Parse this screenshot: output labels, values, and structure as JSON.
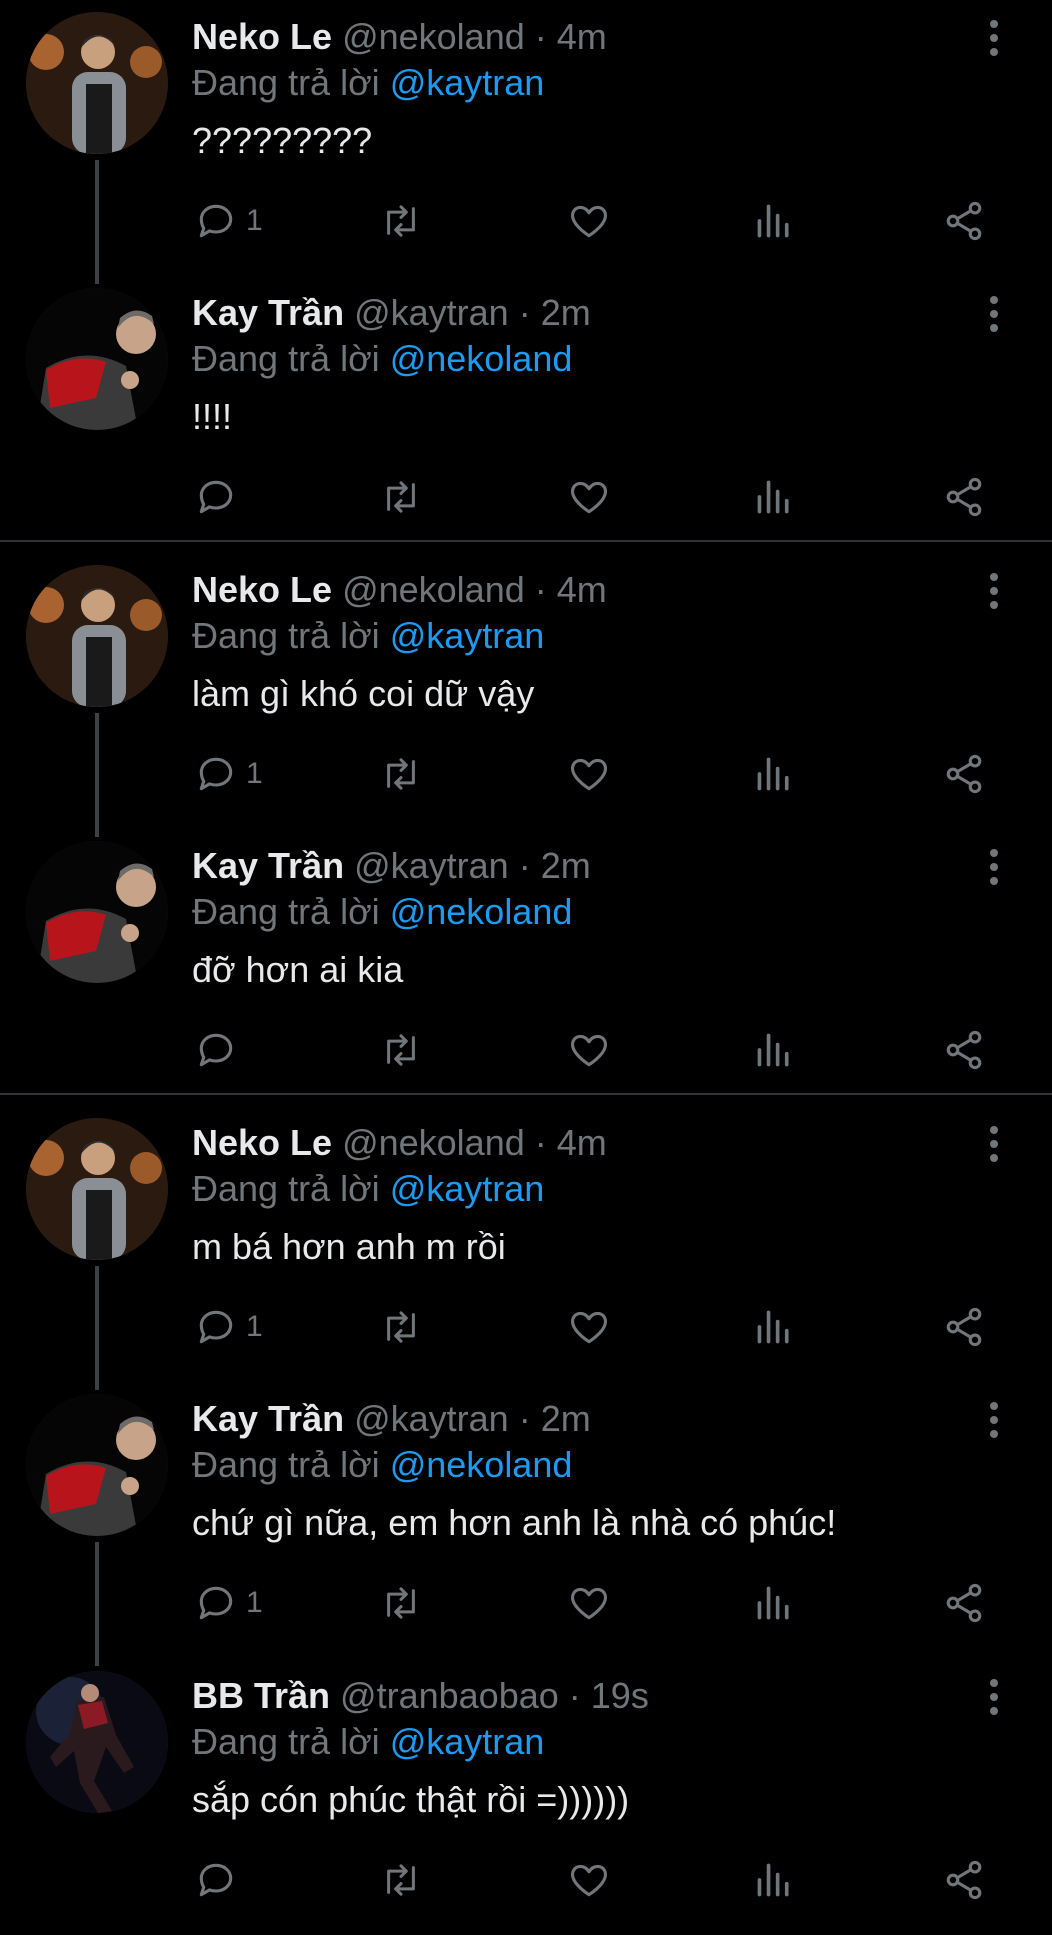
{
  "colors": {
    "background": "#000000",
    "name_text": "#e7e9ea",
    "meta_text": "#71767b",
    "mention": "#1d9bf0",
    "thread_line": "#3d4146",
    "separator": "#2f3336"
  },
  "icons": {
    "more": "more-vertical-icon",
    "reply": "reply-icon",
    "retweet": "retweet-icon",
    "like": "heart-icon",
    "views": "views-icon",
    "share": "share-icon"
  },
  "tweets": [
    {
      "name": "Neko Le",
      "handle": "@nekoland",
      "time": "· 4m",
      "reply_prefix": "Đang trả lời",
      "reply_to": "@kaytran",
      "text": "?????????",
      "reply_count": "1"
    },
    {
      "name": "Kay Trần",
      "handle": "@kaytran",
      "time": "· 2m",
      "reply_prefix": "Đang trả lời",
      "reply_to": "@nekoland",
      "text": "!!!!",
      "reply_count": ""
    },
    {
      "name": "Neko Le",
      "handle": "@nekoland",
      "time": "· 4m",
      "reply_prefix": "Đang trả lời",
      "reply_to": "@kaytran",
      "text": "làm gì khó coi dữ vậy",
      "reply_count": "1"
    },
    {
      "name": "Kay Trần",
      "handle": "@kaytran",
      "time": "· 2m",
      "reply_prefix": "Đang trả lời",
      "reply_to": "@nekoland",
      "text": "đỡ hơn ai kia",
      "reply_count": ""
    },
    {
      "name": "Neko Le",
      "handle": "@nekoland",
      "time": "· 4m",
      "reply_prefix": "Đang trả lời",
      "reply_to": "@kaytran",
      "text": "m bá hơn anh m rồi",
      "reply_count": "1"
    },
    {
      "name": "Kay Trần",
      "handle": "@kaytran",
      "time": "· 2m",
      "reply_prefix": "Đang trả lời",
      "reply_to": "@nekoland",
      "text": "chứ gì nữa, em hơn anh là nhà có phúc!",
      "reply_count": "1"
    },
    {
      "name": "BB Trần",
      "handle": "@tranbaobao",
      "time": "· 19s",
      "reply_prefix": "Đang trả lời",
      "reply_to": "@kaytran",
      "text": "sắp cón phúc thật rồi =))))))",
      "reply_count": ""
    }
  ]
}
